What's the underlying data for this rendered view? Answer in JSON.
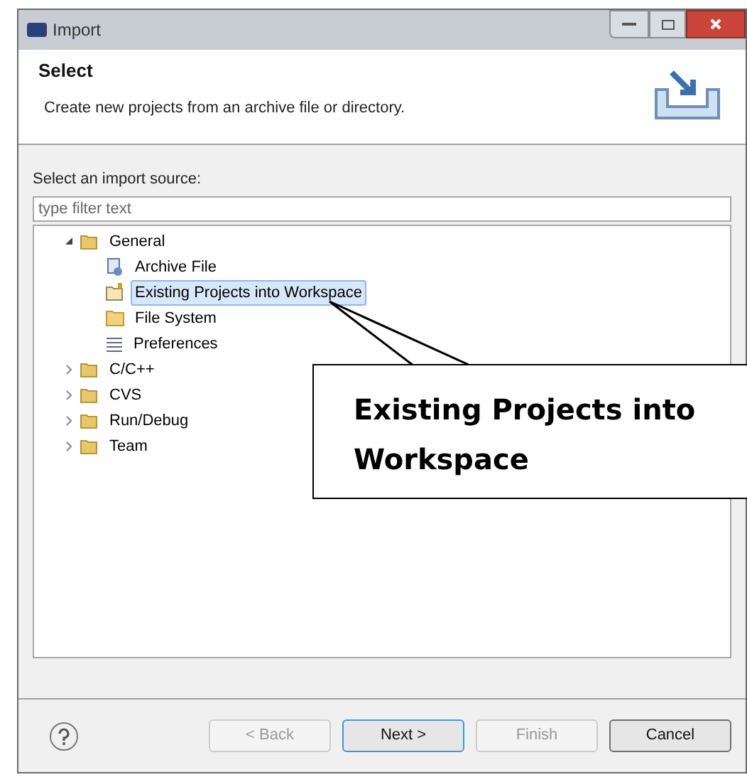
{
  "window": {
    "title": "Import"
  },
  "header": {
    "title": "Select",
    "description": "Create new projects from an archive file or directory."
  },
  "source": {
    "label": "Select an import source:",
    "filter": {
      "placeholder": "type filter text"
    }
  },
  "tree": [
    {
      "label": "General",
      "kind": "folder",
      "expanded": true,
      "selected": false,
      "children": [
        {
          "label": "Archive File",
          "kind": "archive",
          "selected": false
        },
        {
          "label": "Existing Projects into Workspace",
          "kind": "project",
          "selected": true
        },
        {
          "label": "File System",
          "kind": "folder-plain",
          "selected": false
        },
        {
          "label": "Preferences",
          "kind": "list",
          "selected": false
        }
      ]
    },
    {
      "label": "C/C++",
      "kind": "folder",
      "expanded": false,
      "selected": false
    },
    {
      "label": "CVS",
      "kind": "folder",
      "expanded": false,
      "selected": false
    },
    {
      "label": "Run/Debug",
      "kind": "folder",
      "expanded": false,
      "selected": false
    },
    {
      "label": "Team",
      "kind": "folder",
      "expanded": false,
      "selected": false
    }
  ],
  "callout": {
    "text": "Existing Projects into Workspace"
  },
  "buttons": [
    {
      "label": "< Back",
      "disabled": true,
      "default": false
    },
    {
      "label": "Next >",
      "disabled": false,
      "default": true
    },
    {
      "label": "Finish",
      "disabled": true,
      "default": false
    },
    {
      "label": "Cancel",
      "disabled": false,
      "default": false
    }
  ]
}
